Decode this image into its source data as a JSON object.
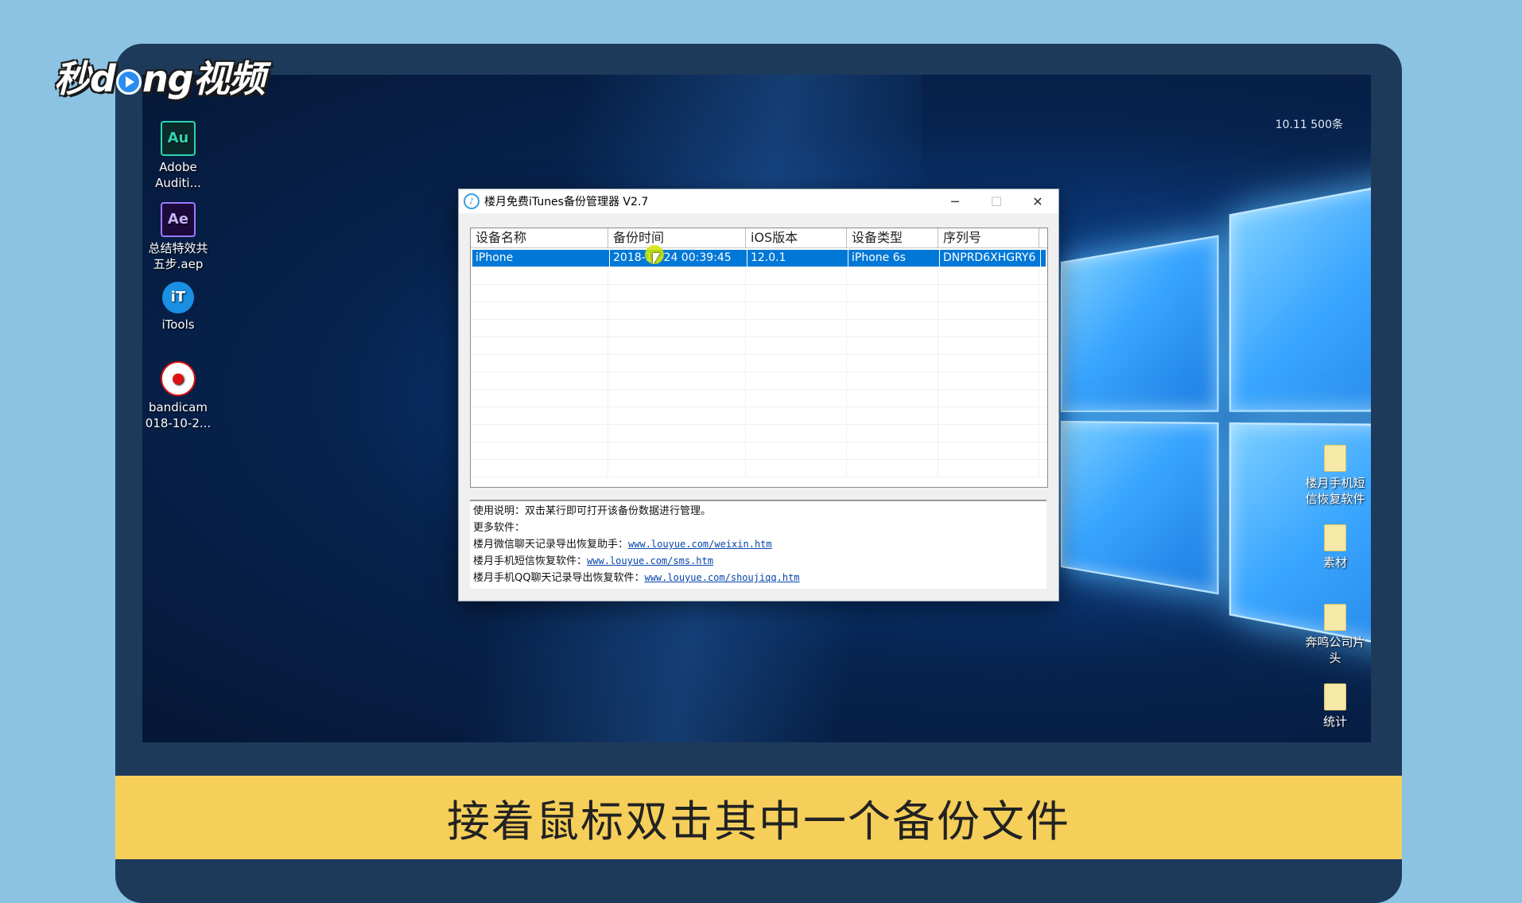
{
  "watermark": {
    "prefix": "秒",
    "mid": "d",
    "suffix": "ng视频"
  },
  "tray": {
    "text": "10.11 500条"
  },
  "desktop_left": [
    {
      "icon": "adobe-audition-icon",
      "glyph": "Au",
      "label1": "Adobe",
      "label2": "Auditi..."
    },
    {
      "icon": "after-effects-icon",
      "glyph": "Ae",
      "label1": "总结特效共",
      "label2": "五步.aep"
    },
    {
      "icon": "itools-icon",
      "glyph": "iT",
      "label1": "iTools",
      "label2": ""
    },
    {
      "icon": "bandicam-video-icon",
      "glyph": "●",
      "label1": "bandicam",
      "label2": "018-10-2..."
    }
  ],
  "desktop_right": [
    {
      "label1": "楼月手机短",
      "label2": "信恢复软件"
    },
    {
      "label1": "素材",
      "label2": ""
    },
    {
      "label1": "奔鸣公司片",
      "label2": "头"
    },
    {
      "label1": "统计",
      "label2": ""
    }
  ],
  "window": {
    "title": "楼月免费iTunes备份管理器 V2.7",
    "minimize": "─",
    "maximize": "☐",
    "close": "✕"
  },
  "table": {
    "headers": [
      "设备名称",
      "备份时间",
      "iOS版本",
      "设备类型",
      "序列号"
    ],
    "rows": [
      [
        "iPhone",
        "2018-10-24 00:39:45",
        "12.0.1",
        "iPhone 6s",
        "DNPRD6XHGRY6"
      ]
    ]
  },
  "info": {
    "usage": "使用说明：双击某行即可打开该备份数据进行管理。",
    "more": "更多软件：",
    "l1_text": "楼月微信聊天记录导出恢复助手：",
    "l1_link": "www.louyue.com/weixin.htm",
    "l2_text": "楼月手机短信恢复软件：",
    "l2_link": "www.louyue.com/sms.htm",
    "l3_text": "楼月手机QQ聊天记录导出恢复软件：",
    "l3_link": "www.louyue.com/shoujiqq.htm"
  },
  "subtitle": "接着鼠标双击其中一个备份文件"
}
